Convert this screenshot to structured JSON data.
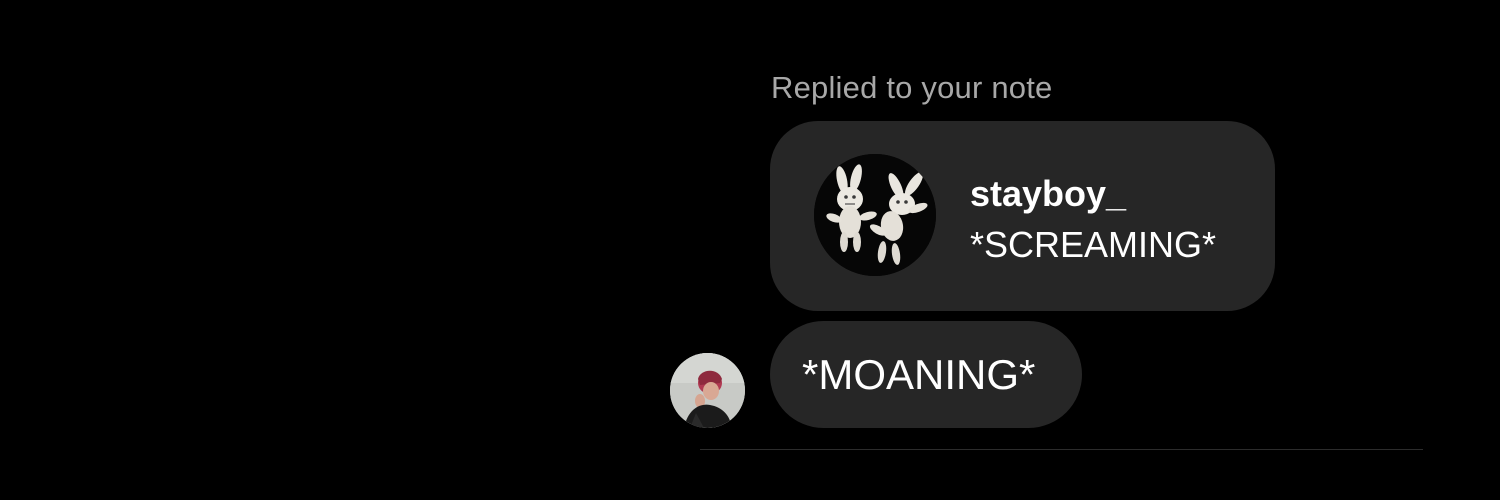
{
  "thread": {
    "reply_caption": "Replied to your note",
    "note": {
      "username": "stayboy_",
      "text": "*SCREAMING*",
      "avatar_icon": "bunny-plush-icon"
    },
    "message": {
      "text": "*MOANING*",
      "avatar_icon": "profile-photo"
    }
  },
  "colors": {
    "background": "#000000",
    "bubble": "#262626",
    "caption": "#a8a8a8",
    "text": "#ffffff"
  }
}
